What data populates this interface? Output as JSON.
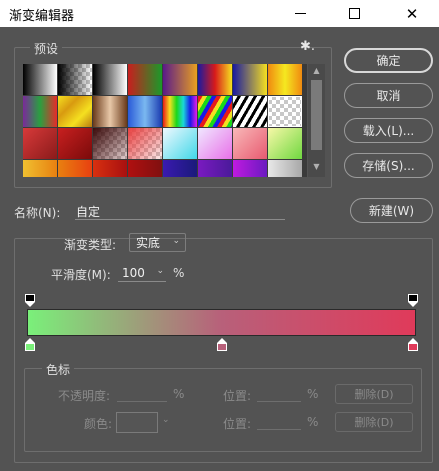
{
  "window": {
    "title": "渐变编辑器",
    "controls": {
      "minimize_icon": "minimize-icon",
      "maximize_icon": "maximize-icon",
      "close_icon": "close-icon",
      "close_glyph": "✕"
    }
  },
  "presets": {
    "label": "预设",
    "menu_icon": "gear-icon",
    "menu_glyph": "✱.",
    "swatches": [
      {
        "bg": "linear-gradient(90deg,#000000,#ffffff)"
      },
      {
        "bg": "linear-gradient(90deg,#000000,rgba(0,0,0,0))",
        "checker": true
      },
      {
        "bg": "linear-gradient(90deg,#000000,#ffffff)"
      },
      {
        "bg": "linear-gradient(90deg,#c81e1e,#1a9a2a)"
      },
      {
        "bg": "linear-gradient(90deg,#5a1a8a,#e8a020)"
      },
      {
        "bg": "linear-gradient(90deg,#1a1aa0,#d81a1a,#f5e020)"
      },
      {
        "bg": "linear-gradient(90deg,#1a1aa0,#f5e020)"
      },
      {
        "bg": "linear-gradient(90deg,#f08a10,#f5e820,#f08a10)"
      },
      {
        "bg": "linear-gradient(90deg,#7a2a9a,#2aa040,#e82a2a)"
      },
      {
        "bg": "linear-gradient(135deg,#f5e020,#d89a10,#f5e020,#b87a10)"
      },
      {
        "bg": "linear-gradient(90deg,#6a3a1a,#e8c8a8,#6a3a1a)"
      },
      {
        "bg": "linear-gradient(90deg,#2a5ad8,#7ab8f0,#1a3ab0)"
      },
      {
        "bg": "linear-gradient(90deg,#e81a1a,#f5e020,#1ad81a,#1ad8d8,#1a1ae8,#e81ae8)"
      },
      {
        "bg": "repeating-linear-gradient(120deg,#e81a1a 0 4px,#f5e020 4px 8px,#1ad81a 8px 12px,#1a1ae8 12px 16px)"
      },
      {
        "bg": "repeating-linear-gradient(120deg,#ffffff 0 4px,#000000 4px 7px)"
      },
      {
        "bg": "linear-gradient(90deg,rgba(0,0,0,0),rgba(0,0,0,0))",
        "checker": true
      },
      {
        "bg": "linear-gradient(135deg,#d83a3a,#8a1a1a)"
      },
      {
        "bg": "linear-gradient(135deg,#c82020,#7a0a0a)"
      },
      {
        "bg": "linear-gradient(135deg,#3a0a0a,rgba(120,20,20,0.2))",
        "checker": true
      },
      {
        "bg": "linear-gradient(135deg,#e84040,rgba(232,64,64,0.1))",
        "checker": true
      },
      {
        "bg": "linear-gradient(135deg,#f0f8ff,#40d8e8)"
      },
      {
        "bg": "linear-gradient(135deg,#f0e8ff,#e870e8)"
      },
      {
        "bg": "linear-gradient(135deg,#f8b8b8,#e85a70)"
      },
      {
        "bg": "linear-gradient(135deg,#f8f8a8,#70d840)"
      },
      {
        "bg": "linear-gradient(90deg,#f0c030,#e88010)"
      },
      {
        "bg": "linear-gradient(90deg,#e88010,#e84010)"
      },
      {
        "bg": "linear-gradient(90deg,#d83010,#a81010)"
      },
      {
        "bg": "linear-gradient(90deg,#b01010,#801010)"
      },
      {
        "bg": "linear-gradient(90deg,#3a1ab0,#1a1a7a)"
      },
      {
        "bg": "linear-gradient(90deg,#7a1ac0,#4a1a9a)"
      },
      {
        "bg": "linear-gradient(90deg,#c01ae0,#6a1ac0)"
      },
      {
        "bg": "linear-gradient(90deg,#e8e8e8,#a8a8a8)"
      }
    ],
    "selected_index": 15
  },
  "buttons": {
    "ok": "确定",
    "cancel": "取消",
    "load": "载入(L)...",
    "save": "存储(S)...",
    "new": "新建(W)"
  },
  "name": {
    "label": "名称(N):",
    "value": "自定"
  },
  "gradient": {
    "type_label": "渐变类型:",
    "type_value": "实底",
    "smoothness_label": "平滑度(M):",
    "smoothness_value": "100",
    "smoothness_unit": "%",
    "bar_colors": [
      "#7af07a",
      "#b8607a",
      "#e03a5a"
    ],
    "opacity_stops": [
      {
        "position": 0,
        "opacity": 100
      },
      {
        "position": 100,
        "opacity": 100
      }
    ],
    "color_stops": [
      {
        "position": 0,
        "color": "#7af07a"
      },
      {
        "position": 50,
        "color": "#b8607a"
      },
      {
        "position": 100,
        "color": "#e03a5a"
      }
    ]
  },
  "stops_panel": {
    "title": "色标",
    "opacity_label": "不透明度:",
    "opacity_unit": "%",
    "position_label": "位置:",
    "position_unit": "%",
    "delete_label": "删除(D)",
    "color_label": "颜色:",
    "caret": "⌄"
  },
  "carets": {
    "dropdown": "⌄",
    "scroll_up": "▲",
    "scroll_down": "▼"
  },
  "colors": {
    "panel_bg": "#535353",
    "border": "#6e6e6e"
  }
}
